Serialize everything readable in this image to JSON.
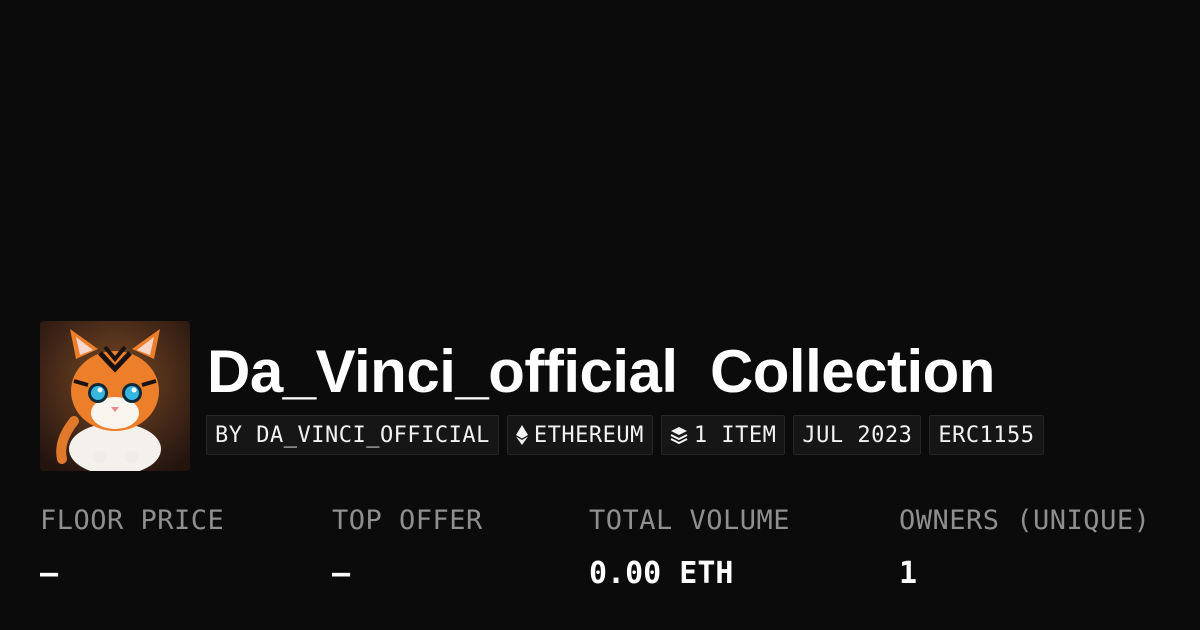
{
  "collection": {
    "name": "Da_Vinci_official",
    "suffix": "Collection",
    "avatar_icon": "tiger-cub-avatar"
  },
  "chips": {
    "creator": "BY DA_VINCI_OFFICIAL",
    "chain": "ETHEREUM",
    "chain_icon": "ethereum-icon",
    "items": "1 ITEM",
    "items_icon": "layers-icon",
    "date": "JUL 2023",
    "standard": "ERC1155"
  },
  "stats": {
    "floor_price": {
      "label": "FLOOR PRICE",
      "value": "—"
    },
    "top_offer": {
      "label": "TOP OFFER",
      "value": "—"
    },
    "total_volume": {
      "label": "TOTAL VOLUME",
      "value": "0.00 ETH"
    },
    "owners": {
      "label": "OWNERS (UNIQUE)",
      "value": "1"
    }
  },
  "colors": {
    "background": "#0b0b0b",
    "chip_background": "#161616",
    "muted_text": "#8f8f8f"
  }
}
